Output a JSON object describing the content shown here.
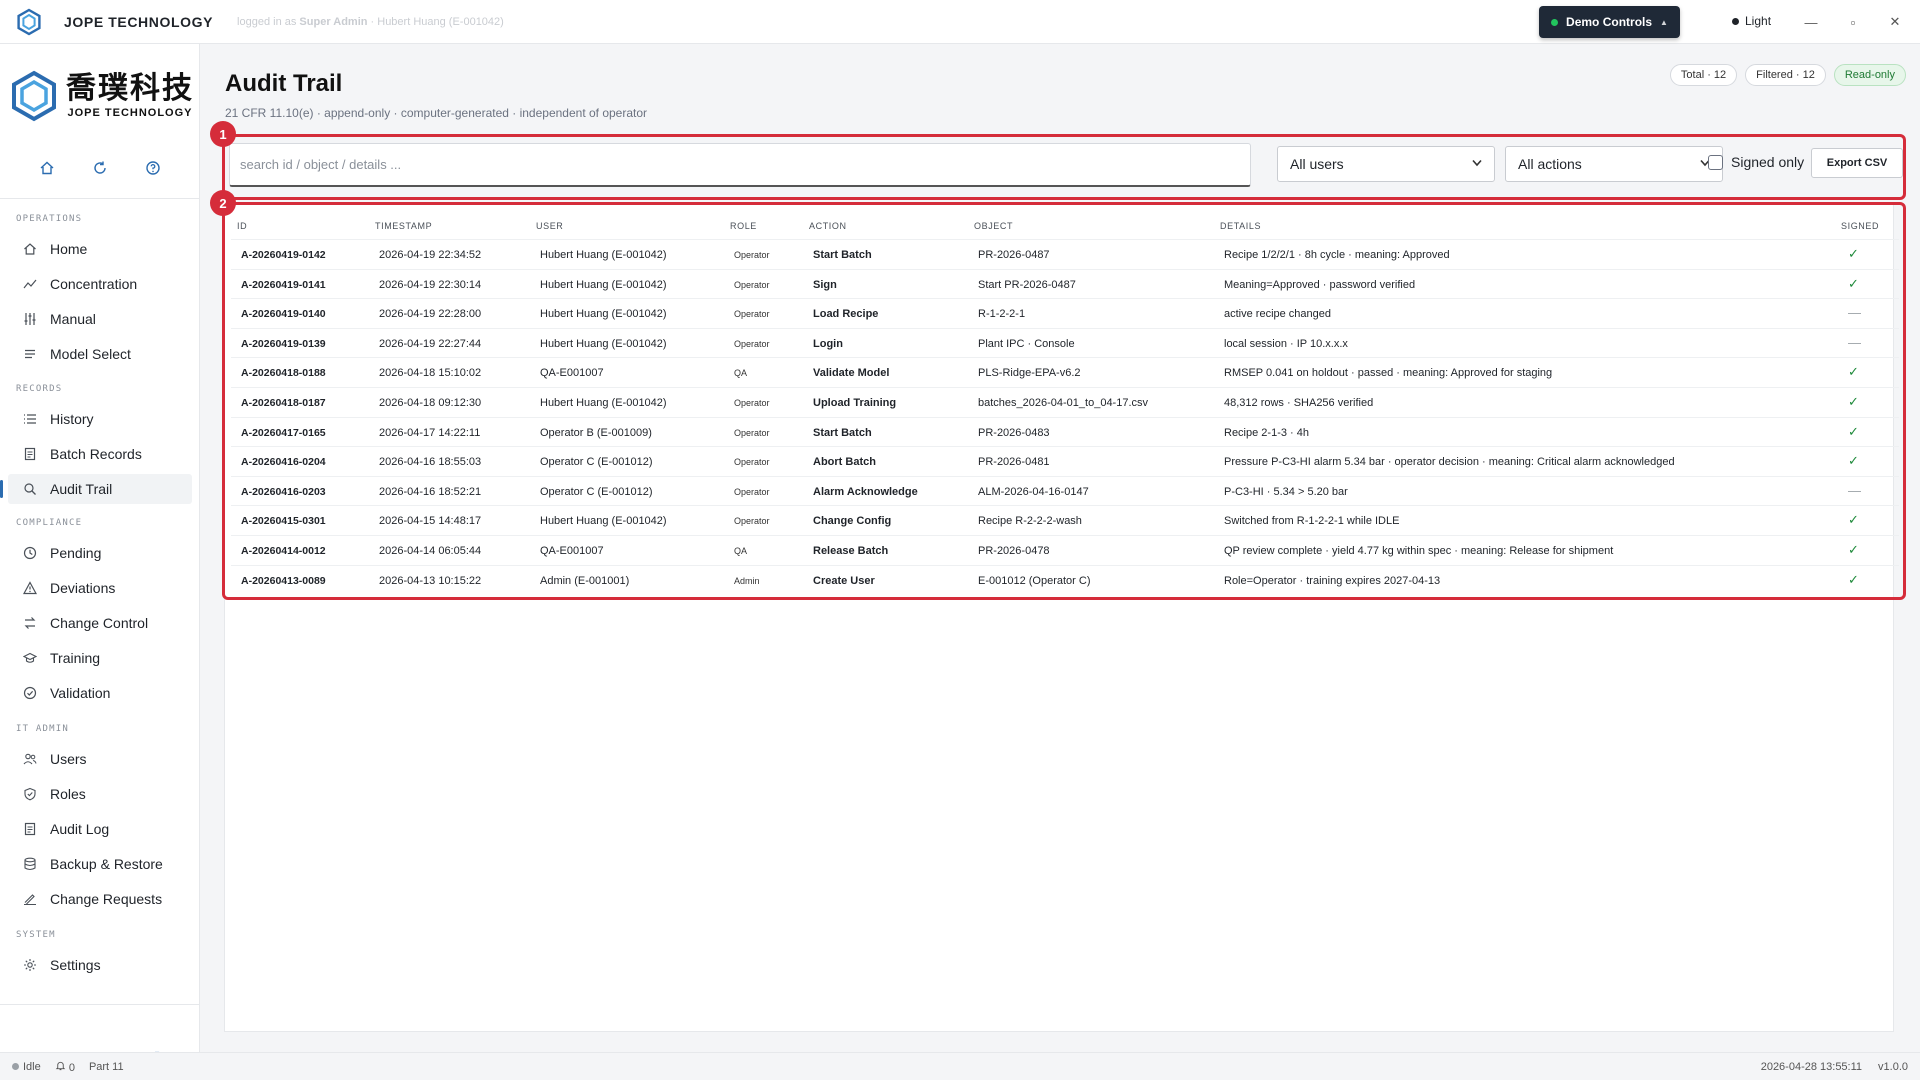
{
  "titlebar": {
    "brand": "JOPE TECHNOLOGY",
    "user_prefix": "logged in as",
    "user_role": "Super Admin",
    "user_name": "· Hubert Huang (E-001042)",
    "demo_label": "Demo Controls",
    "demo_caret": "▲",
    "theme_label": "Light",
    "minimize": "—",
    "maximize": "▫",
    "close": "✕"
  },
  "sidebar": {
    "logo_cn": "喬璞科技",
    "logo_en": "JOPE TECHNOLOGY",
    "sections": {
      "operations": "OPERATIONS",
      "records": "RECORDS",
      "compliance": "COMPLIANCE",
      "it_admin": "IT ADMIN",
      "system": "SYSTEM"
    },
    "items": {
      "home": "Home",
      "concentration": "Concentration",
      "manual": "Manual",
      "model_select": "Model Select",
      "history": "History",
      "batch_records": "Batch Records",
      "audit_trail": "Audit Trail",
      "pending": "Pending",
      "deviations": "Deviations",
      "change_control": "Change Control",
      "training": "Training",
      "validation": "Validation",
      "users": "Users",
      "roles": "Roles",
      "audit_log": "Audit Log",
      "backup_restore": "Backup & Restore",
      "change_requests": "Change Requests",
      "settings": "Settings"
    }
  },
  "page": {
    "title": "Audit Trail",
    "subtitle": "21 CFR 11.10(e) · append-only · computer-generated · independent of operator",
    "pills": {
      "total": "Total · 12",
      "filtered": "Filtered · 12",
      "readonly": "Read-only"
    }
  },
  "filters": {
    "search_placeholder": "search id / object / details ...",
    "users_select": "All users",
    "actions_select": "All actions",
    "signed_only_label": "Signed only",
    "export_label": "Export CSV",
    "badge_1": "1",
    "badge_2": "2"
  },
  "table": {
    "headers": {
      "id": "ID",
      "timestamp": "TIMESTAMP",
      "user": "USER",
      "role": "ROLE",
      "action": "ACTION",
      "object": "OBJECT",
      "details": "DETAILS",
      "signed": "SIGNED"
    },
    "rows": [
      {
        "id": "A-20260419-0142",
        "timestamp": "2026-04-19 22:34:52",
        "user": "Hubert Huang (E-001042)",
        "role": "Operator",
        "action": "Start Batch",
        "object": "PR-2026-0487",
        "details": "Recipe 1/2/2/1 · 8h cycle · meaning: Approved",
        "signed": "✓"
      },
      {
        "id": "A-20260419-0141",
        "timestamp": "2026-04-19 22:30:14",
        "user": "Hubert Huang (E-001042)",
        "role": "Operator",
        "action": "Sign",
        "object": "Start PR-2026-0487",
        "details": "Meaning=Approved · password verified",
        "signed": "✓"
      },
      {
        "id": "A-20260419-0140",
        "timestamp": "2026-04-19 22:28:00",
        "user": "Hubert Huang (E-001042)",
        "role": "Operator",
        "action": "Load Recipe",
        "object": "R-1-2-2-1",
        "details": "active recipe changed",
        "signed": "—"
      },
      {
        "id": "A-20260419-0139",
        "timestamp": "2026-04-19 22:27:44",
        "user": "Hubert Huang (E-001042)",
        "role": "Operator",
        "action": "Login",
        "object": "Plant IPC · Console",
        "details": "local session · IP 10.x.x.x",
        "signed": "—"
      },
      {
        "id": "A-20260418-0188",
        "timestamp": "2026-04-18 15:10:02",
        "user": "QA-E001007",
        "role": "QA",
        "action": "Validate Model",
        "object": "PLS-Ridge-EPA-v6.2",
        "details": "RMSEP 0.041 on holdout · passed · meaning: Approved for staging",
        "signed": "✓"
      },
      {
        "id": "A-20260418-0187",
        "timestamp": "2026-04-18 09:12:30",
        "user": "Hubert Huang (E-001042)",
        "role": "Operator",
        "action": "Upload Training",
        "object": "batches_2026-04-01_to_04-17.csv",
        "details": "48,312 rows · SHA256 verified",
        "signed": "✓"
      },
      {
        "id": "A-20260417-0165",
        "timestamp": "2026-04-17 14:22:11",
        "user": "Operator B (E-001009)",
        "role": "Operator",
        "action": "Start Batch",
        "object": "PR-2026-0483",
        "details": "Recipe 2-1-3 · 4h",
        "signed": "✓"
      },
      {
        "id": "A-20260416-0204",
        "timestamp": "2026-04-16 18:55:03",
        "user": "Operator C (E-001012)",
        "role": "Operator",
        "action": "Abort Batch",
        "object": "PR-2026-0481",
        "details": "Pressure P-C3-HI alarm 5.34 bar · operator decision · meaning: Critical alarm acknowledged",
        "signed": "✓"
      },
      {
        "id": "A-20260416-0203",
        "timestamp": "2026-04-16 18:52:21",
        "user": "Operator C (E-001012)",
        "role": "Operator",
        "action": "Alarm Acknowledge",
        "object": "ALM-2026-04-16-0147",
        "details": "P-C3-HI · 5.34 > 5.20 bar",
        "signed": "—"
      },
      {
        "id": "A-20260415-0301",
        "timestamp": "2026-04-15 14:48:17",
        "user": "Hubert Huang (E-001042)",
        "role": "Operator",
        "action": "Change Config",
        "object": "Recipe R-2-2-2-wash",
        "details": "Switched from R-1-2-2-1 while IDLE",
        "signed": "✓"
      },
      {
        "id": "A-20260414-0012",
        "timestamp": "2026-04-14 06:05:44",
        "user": "QA-E001007",
        "role": "QA",
        "action": "Release Batch",
        "object": "PR-2026-0478",
        "details": "QP review complete · yield 4.77 kg within spec · meaning: Release for shipment",
        "signed": "✓"
      },
      {
        "id": "A-20260413-0089",
        "timestamp": "2026-04-13 10:15:22",
        "user": "Admin (E-001001)",
        "role": "Admin",
        "action": "Create User",
        "object": "E-001012 (Operator C)",
        "details": "Role=Operator · training expires 2027-04-13",
        "signed": "✓"
      }
    ]
  },
  "statusbar": {
    "state": "Idle",
    "bell_count": "0",
    "part": "Part 11",
    "datetime": "2026-04-28 13:55:11",
    "version": "v1.0.0"
  },
  "colors": {
    "accent": "#2b6cb0",
    "highlight": "#d52c3a",
    "signed_ok": "#1f8a3b"
  }
}
